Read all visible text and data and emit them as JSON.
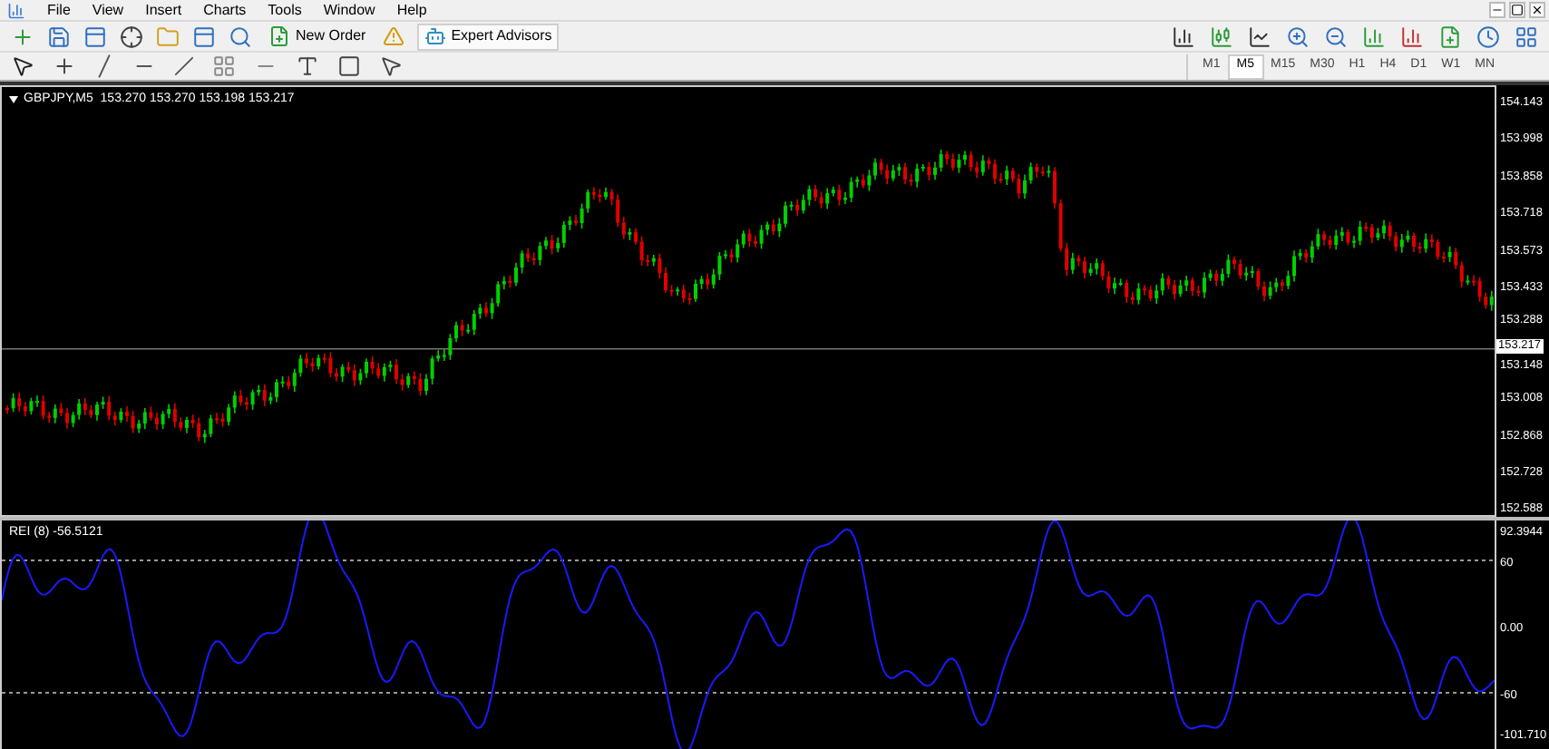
{
  "menu": [
    "File",
    "View",
    "Insert",
    "Charts",
    "Tools",
    "Window",
    "Help"
  ],
  "toolbar": {
    "new_order": "New Order",
    "expert_advisors": {
      "label": "Expert Advisors",
      "on": true
    }
  },
  "timeframes": [
    {
      "label": "M1",
      "selected": false
    },
    {
      "label": "M5",
      "selected": true
    },
    {
      "label": "M15",
      "selected": false
    },
    {
      "label": "M30",
      "selected": false
    },
    {
      "label": "H1",
      "selected": false
    },
    {
      "label": "H4",
      "selected": false
    },
    {
      "label": "D1",
      "selected": false
    },
    {
      "label": "W1",
      "selected": false
    },
    {
      "label": "MN",
      "selected": false
    }
  ],
  "chart": {
    "title": "GBPJPY,M5  153.270 153.270 153.198 153.217",
    "price_ticks": [
      "154.143",
      "153.998",
      "153.858",
      "153.718",
      "153.573",
      "153.433",
      "153.288",
      "153.148",
      "153.008",
      "152.868",
      "152.728",
      "152.588"
    ],
    "current_price": "153.217"
  },
  "indicator": {
    "title": "REI (8) -56.5121",
    "ticks": [
      "92.3944",
      "60",
      "0.00",
      "-60",
      "-101.710"
    ]
  }
}
